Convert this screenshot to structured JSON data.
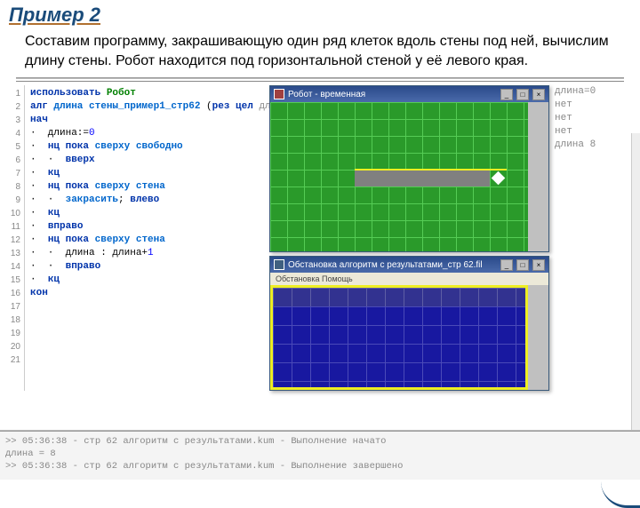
{
  "header": {
    "title": "Пример 2",
    "description": "Составим программу, закрашивающую один ряд клеток вдоль стены под ней, вычислим длину стены. Робот находится под горизонтальной стеной у её левого края."
  },
  "code": {
    "lines": [
      {
        "n": "1",
        "parts": [
          {
            "t": "использовать ",
            "c": "kw"
          },
          {
            "t": "Робот",
            "c": "name"
          }
        ]
      },
      {
        "n": "2",
        "parts": [
          {
            "t": "алг ",
            "c": "kw"
          },
          {
            "t": "длина стены_пример1_стр62",
            "c": "kw2"
          },
          {
            "t": " (",
            "c": ""
          },
          {
            "t": "рез цел",
            "c": "kw"
          },
          {
            "t": " длина)",
            "c": "gray"
          }
        ]
      },
      {
        "n": "3",
        "parts": []
      },
      {
        "n": "4",
        "parts": [
          {
            "t": "нач",
            "c": "kw"
          }
        ]
      },
      {
        "n": "5",
        "parts": [
          {
            "t": "·  длина:=",
            "c": ""
          },
          {
            "t": "0",
            "c": "num"
          }
        ]
      },
      {
        "n": "6",
        "parts": [
          {
            "t": "·  ",
            "c": ""
          },
          {
            "t": "нц пока",
            "c": "kw"
          },
          {
            "t": " ",
            "c": ""
          },
          {
            "t": "сверху свободно",
            "c": "kw2"
          }
        ]
      },
      {
        "n": "7",
        "parts": [
          {
            "t": "·  ·  ",
            "c": ""
          },
          {
            "t": "вверх",
            "c": "kw"
          }
        ]
      },
      {
        "n": "8",
        "parts": [
          {
            "t": "·  ",
            "c": ""
          },
          {
            "t": "кц",
            "c": "kw"
          }
        ]
      },
      {
        "n": "9",
        "parts": [
          {
            "t": "·  ",
            "c": ""
          },
          {
            "t": "нц пока",
            "c": "kw"
          },
          {
            "t": " ",
            "c": ""
          },
          {
            "t": "сверху стена",
            "c": "kw2"
          }
        ]
      },
      {
        "n": "10",
        "parts": [
          {
            "t": "·  ·  ",
            "c": ""
          },
          {
            "t": "закрасить",
            "c": "kw2"
          },
          {
            "t": "; ",
            "c": ""
          },
          {
            "t": "влево",
            "c": "kw"
          }
        ]
      },
      {
        "n": "11",
        "parts": [
          {
            "t": "·  ",
            "c": ""
          },
          {
            "t": "кц",
            "c": "kw"
          }
        ]
      },
      {
        "n": "12",
        "parts": [
          {
            "t": "·  ",
            "c": ""
          },
          {
            "t": "вправо",
            "c": "kw"
          }
        ]
      },
      {
        "n": "13",
        "parts": [
          {
            "t": "·  ",
            "c": ""
          },
          {
            "t": "нц пока",
            "c": "kw"
          },
          {
            "t": " ",
            "c": ""
          },
          {
            "t": "сверху стена",
            "c": "kw2"
          }
        ]
      },
      {
        "n": "14",
        "parts": [
          {
            "t": "·  ·  длина : длина+",
            "c": ""
          },
          {
            "t": "1",
            "c": "num"
          }
        ]
      },
      {
        "n": "15",
        "parts": [
          {
            "t": "·  ·  ",
            "c": ""
          },
          {
            "t": "вправо",
            "c": "kw"
          }
        ]
      },
      {
        "n": "16",
        "parts": [
          {
            "t": "·  ",
            "c": ""
          },
          {
            "t": "кц",
            "c": "kw"
          }
        ]
      },
      {
        "n": "17",
        "parts": [
          {
            "t": "кон",
            "c": "kw"
          }
        ]
      },
      {
        "n": "18",
        "parts": []
      },
      {
        "n": "19",
        "parts": []
      },
      {
        "n": "20",
        "parts": []
      },
      {
        "n": "21",
        "parts": []
      }
    ]
  },
  "annotations": [
    "",
    "",
    "",
    "",
    "длина=0",
    "нет",
    "",
    "",
    "нет",
    "",
    "",
    "",
    "нет",
    "длина 8",
    "",
    "",
    ""
  ],
  "win1": {
    "title": "Робот - временная"
  },
  "win2": {
    "title": "Обстановка  алгоритм с результатами_стр 62.fil",
    "menu": "Обстановка   Помощь"
  },
  "console": {
    "l1": ">> 05:36:38 - стр 62 алгоритм с результатами.kum - Выполнение начато",
    "l2": "длина = 8",
    "l3": ">> 05:36:38 - стр 62 алгоритм с результатами.kum - Выполнение завершено"
  },
  "btns": {
    "min": "_",
    "max": "□",
    "close": "×"
  }
}
